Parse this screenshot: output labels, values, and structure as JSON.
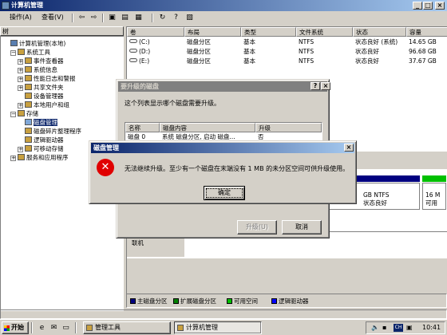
{
  "window": {
    "title": "计算机管理"
  },
  "menu": {
    "action": "操作(A)",
    "view": "查看(V)"
  },
  "left_pane": {
    "header": "树"
  },
  "tree": [
    {
      "label": "计算机管理(本地)",
      "indent": 0,
      "exp": ""
    },
    {
      "label": "系统工具",
      "indent": 1,
      "exp": "−"
    },
    {
      "label": "事件查看器",
      "indent": 2,
      "exp": "+"
    },
    {
      "label": "系统信息",
      "indent": 2,
      "exp": "+"
    },
    {
      "label": "性能日志和警报",
      "indent": 2,
      "exp": "+"
    },
    {
      "label": "共享文件夹",
      "indent": 2,
      "exp": "+"
    },
    {
      "label": "设备管理器",
      "indent": 2,
      "exp": ""
    },
    {
      "label": "本地用户和组",
      "indent": 2,
      "exp": "+"
    },
    {
      "label": "存储",
      "indent": 1,
      "exp": "−"
    },
    {
      "label": "磁盘管理",
      "indent": 2,
      "exp": "",
      "selected": true
    },
    {
      "label": "磁盘碎片整理程序",
      "indent": 2,
      "exp": ""
    },
    {
      "label": "逻辑驱动器",
      "indent": 2,
      "exp": ""
    },
    {
      "label": "可移动存储",
      "indent": 2,
      "exp": "+"
    },
    {
      "label": "服务和应用程序",
      "indent": 1,
      "exp": "+"
    }
  ],
  "volume_columns": [
    "卷",
    "布局",
    "类型",
    "文件系统",
    "状态",
    "容量"
  ],
  "volumes": [
    {
      "vol": "(C:)",
      "layout": "磁盘分区",
      "type": "基本",
      "fs": "NTFS",
      "status": "状态良好 (系统)",
      "capacity": "14.65 GB"
    },
    {
      "vol": "(D:)",
      "layout": "磁盘分区",
      "type": "基本",
      "fs": "NTFS",
      "status": "状态良好",
      "capacity": "96.68 GB"
    },
    {
      "vol": "(E:)",
      "layout": "磁盘分区",
      "type": "基本",
      "fs": "NTFS",
      "status": "状态良好",
      "capacity": "37.67 GB"
    }
  ],
  "graph": {
    "partial_fs": "GB NTFS",
    "partial_status": "状态良好",
    "partial_size": "16 M",
    "partial_unalloc": "可用",
    "cdrom_label": "联机"
  },
  "legend": [
    {
      "label": "主磁盘分区",
      "color": "#000080"
    },
    {
      "label": "扩展磁盘分区",
      "color": "#008000"
    },
    {
      "label": "可用空间",
      "color": "#00c000"
    },
    {
      "label": "逻辑驱动器",
      "color": "#0000ff"
    }
  ],
  "upgrade_dialog": {
    "title": "要升级的磁盘",
    "help_btn": "?",
    "close_btn": "×",
    "prompt": "这个列表显示哪个磁盘需要升级。",
    "columns": [
      "名称",
      "磁盘内容",
      "升级"
    ],
    "row": {
      "name": "磁盘 0",
      "content": "系统 磁盘分区, 启动 磁盘...",
      "upgrade": "否"
    },
    "upgrade_btn": "升级(U)",
    "cancel_btn": "取消"
  },
  "error_dialog": {
    "title": "磁盘管理",
    "message": "无法继续升级。至少有一个磁盘在末端没有 1 MB 的未分区空间可供升级使用。",
    "ok_btn": "确定"
  },
  "taskbar": {
    "start": "开始",
    "tasks": [
      {
        "label": "管理工具",
        "active": false
      },
      {
        "label": "计算机管理",
        "active": true
      }
    ],
    "ime": "CH",
    "clock": "10:41"
  }
}
